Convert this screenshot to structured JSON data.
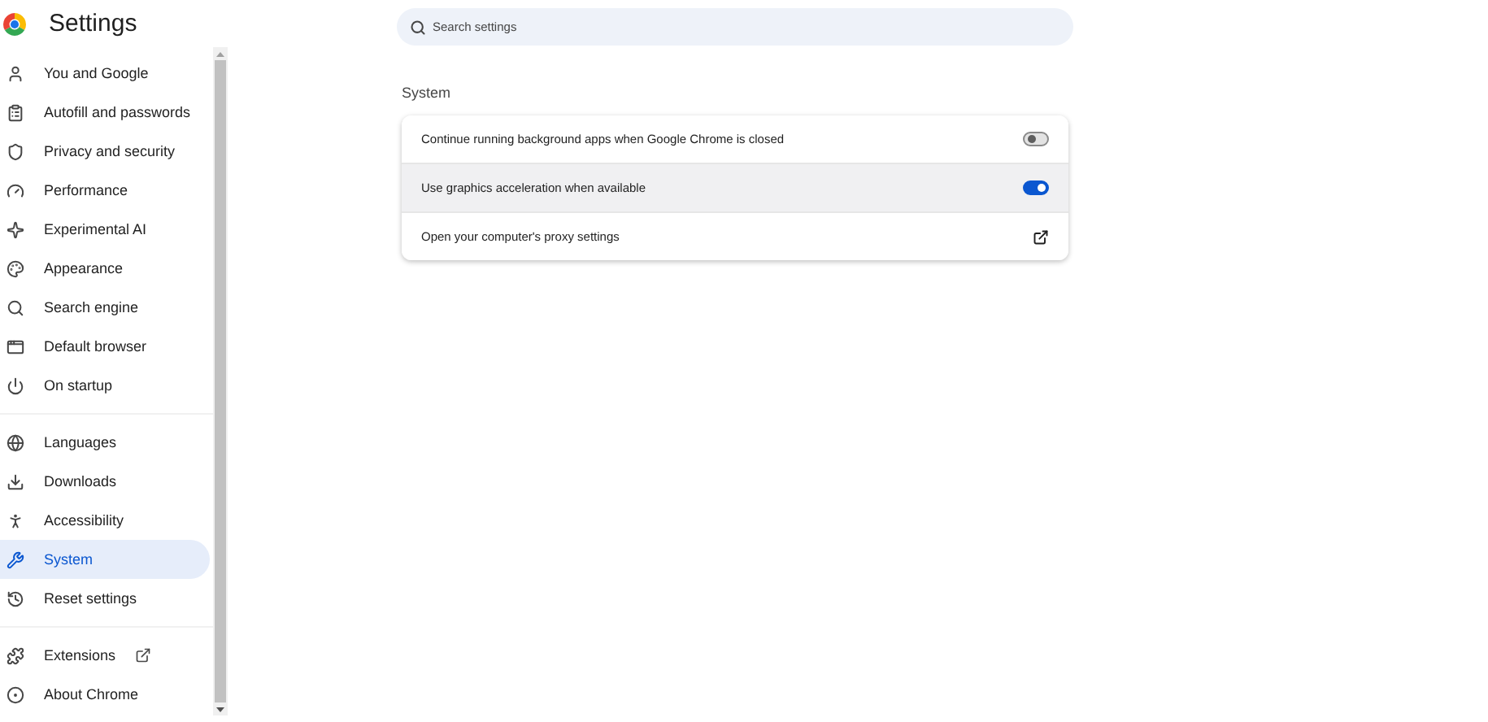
{
  "header": {
    "title": "Settings"
  },
  "search": {
    "placeholder": "Search settings"
  },
  "nav_groups": [
    {
      "items": [
        {
          "label": "You and Google",
          "selected": false
        },
        {
          "label": "Autofill and passwords",
          "selected": false
        },
        {
          "label": "Privacy and security",
          "selected": false
        },
        {
          "label": "Performance",
          "selected": false
        },
        {
          "label": "Experimental AI",
          "selected": false
        },
        {
          "label": "Appearance",
          "selected": false
        },
        {
          "label": "Search engine",
          "selected": false
        },
        {
          "label": "Default browser",
          "selected": false
        },
        {
          "label": "On startup",
          "selected": false
        }
      ]
    },
    {
      "items": [
        {
          "label": "Languages",
          "selected": false
        },
        {
          "label": "Downloads",
          "selected": false
        },
        {
          "label": "Accessibility",
          "selected": false
        },
        {
          "label": "System",
          "selected": true
        },
        {
          "label": "Reset settings",
          "selected": false
        }
      ]
    },
    {
      "items": [
        {
          "label": "Extensions",
          "selected": false,
          "external": true
        },
        {
          "label": "About Chrome",
          "selected": false,
          "external": false
        }
      ]
    }
  ],
  "section": {
    "title": "System",
    "rows": [
      {
        "kind": "toggle",
        "label": "Continue running background apps when Google Chrome is closed",
        "on": false,
        "hovered": false
      },
      {
        "kind": "toggle",
        "label": "Use graphics acceleration when available",
        "on": true,
        "hovered": true
      },
      {
        "kind": "link",
        "label": "Open your computer's proxy settings",
        "hovered": false
      }
    ]
  }
}
